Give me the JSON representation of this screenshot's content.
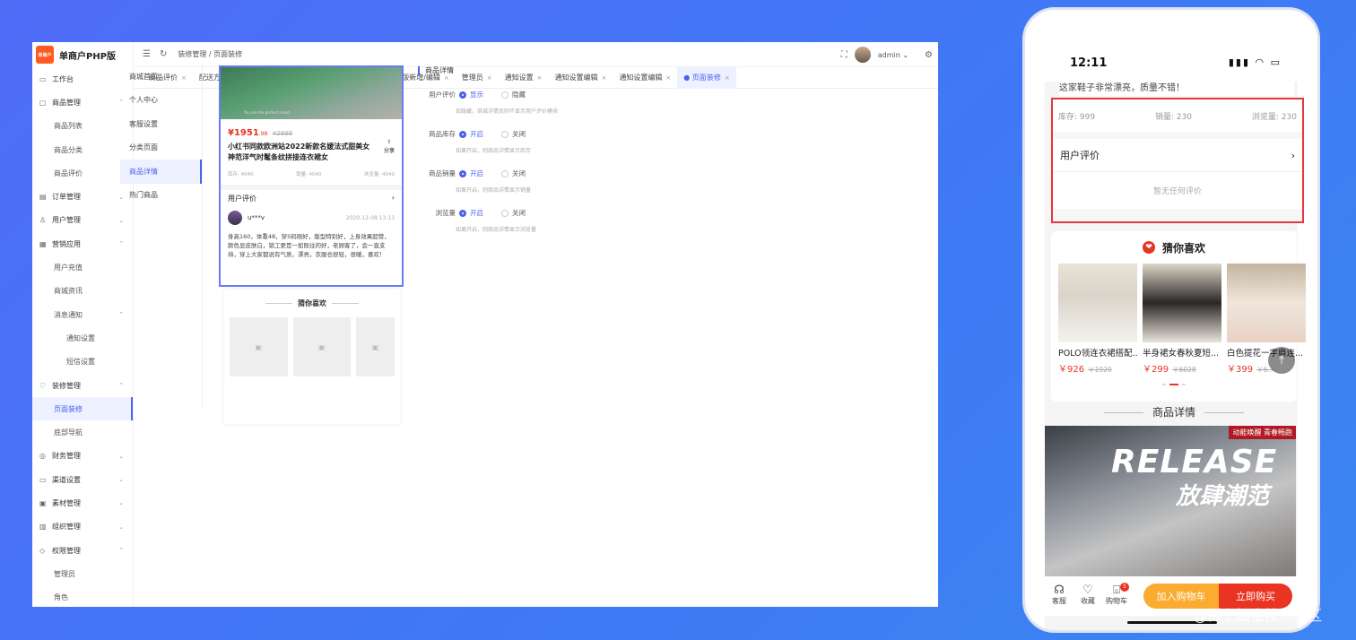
{
  "sidebar": {
    "brand_logo": "单商户",
    "brand_name": "单商户PHP版",
    "items": [
      {
        "label": "工作台",
        "level": "top",
        "icon": "▭",
        "chev": ""
      },
      {
        "label": "商品管理",
        "level": "top",
        "icon": "▢",
        "chev": "⌃"
      },
      {
        "label": "商品列表",
        "level": "sub"
      },
      {
        "label": "商品分类",
        "level": "sub"
      },
      {
        "label": "商品评价",
        "level": "sub"
      },
      {
        "label": "订单管理",
        "level": "top",
        "icon": "▤",
        "chev": "⌄"
      },
      {
        "label": "用户管理",
        "level": "top",
        "icon": "♙",
        "chev": "⌄"
      },
      {
        "label": "营销应用",
        "level": "top",
        "icon": "▦",
        "chev": "⌃"
      },
      {
        "label": "用户充值",
        "level": "sub"
      },
      {
        "label": "商城资讯",
        "level": "sub"
      },
      {
        "label": "消息通知",
        "level": "sub",
        "chev": "⌃"
      },
      {
        "label": "通知设置",
        "level": "sub2"
      },
      {
        "label": "短信设置",
        "level": "sub2"
      },
      {
        "label": "装修管理",
        "level": "top",
        "icon": "♡",
        "chev": "⌃"
      },
      {
        "label": "页面装修",
        "level": "sub",
        "active": true
      },
      {
        "label": "底部导航",
        "level": "sub"
      },
      {
        "label": "财务管理",
        "level": "top",
        "icon": "◎",
        "chev": "⌄"
      },
      {
        "label": "渠道设置",
        "level": "top",
        "icon": "▭",
        "chev": "⌄"
      },
      {
        "label": "素材管理",
        "level": "top",
        "icon": "▣",
        "chev": "⌄"
      },
      {
        "label": "组织管理",
        "level": "top",
        "icon": "▥",
        "chev": "⌄"
      },
      {
        "label": "权限管理",
        "level": "top",
        "icon": "◇",
        "chev": "⌃"
      },
      {
        "label": "管理员",
        "level": "sub"
      },
      {
        "label": "角色",
        "level": "sub"
      }
    ]
  },
  "topbar": {
    "collapse_icon": "☰",
    "refresh_icon": "↻",
    "breadcrumb": "装修管理  /  页面装修",
    "fullscreen_icon": "⛶",
    "user_name": "admin ⌄",
    "settings_icon": "⚙"
  },
  "tabs": [
    {
      "label": "商品评价"
    },
    {
      "label": "配送方式"
    },
    {
      "label": "运费模版"
    },
    {
      "label": "运费模版新增/编辑"
    },
    {
      "label": "运费模版新增/编辑"
    },
    {
      "label": "管理员"
    },
    {
      "label": "通知设置"
    },
    {
      "label": "通知设置编辑"
    },
    {
      "label": "通知设置编辑"
    },
    {
      "label": "● 页面装修",
      "active": true
    }
  ],
  "tab_close": "×",
  "subnav": [
    {
      "label": "商城首页"
    },
    {
      "label": "个人中心"
    },
    {
      "label": "客服设置"
    },
    {
      "label": "分类页面"
    },
    {
      "label": "商品详情",
      "active": true
    },
    {
      "label": "热门商品"
    }
  ],
  "preview": {
    "caption": "You are the perfect mood",
    "price": "¥1951",
    "price_decimal": ".98",
    "old_price": "¥2999",
    "title": "小红书同款欧洲站2022新款名媛法式甜美女神范洋气时髦条纹拼接连衣裙女",
    "share_icon": "⇪",
    "share_label": "分享",
    "stock": "库存: 4040",
    "sales": "销量: 4040",
    "views": "浏览量: 4040",
    "review_title": "用户评价",
    "review_arrow": "›",
    "user": "u***v",
    "time": "2020-12-08 13:13",
    "review_text": "身高160，体重48，穿S码刚好，版型特别好，上身效果超赞，颜色显皮肤白，锁工更是一如既往的好，老顾客了，会一直支持，穿上大家都说有气质，漂亮，衣服也很轻，很暖，喜欢！",
    "guess_title": "猜你喜欢",
    "img_icon": "▣"
  },
  "settings": {
    "header": "商品详情",
    "rows": [
      {
        "label": "用户评价",
        "opt_a": "显示",
        "opt_b": "隐藏",
        "hint": "如隐藏，商城详情页则不显示用户评价模块"
      },
      {
        "label": "商品库存",
        "opt_a": "开启",
        "opt_b": "关闭",
        "hint": "如果开启，则商品详情显示库存"
      },
      {
        "label": "商品销量",
        "opt_a": "开启",
        "opt_b": "关闭",
        "hint": "如果开启，则商品详情显示销量"
      },
      {
        "label": "浏览量",
        "opt_a": "开启",
        "opt_b": "关闭",
        "hint": "如果开启，则商品详情显示浏览量"
      }
    ]
  },
  "mobile": {
    "time": "12:11",
    "status_icons": "▮▮▮ ◠ ▭",
    "review_note": "这家鞋子非常漂亮，质量不错！",
    "stock": "库存: 999",
    "sales": "销量: 230",
    "views": "浏览量: 230",
    "review_title": "用户评价",
    "review_arrow": "›",
    "no_review": "暂无任何评价",
    "guess_title": "猜你喜欢",
    "heart_icon": "❤",
    "products": [
      {
        "name": "POLO领连衣裙搭配...",
        "price": "￥926",
        "old": "￥1920"
      },
      {
        "name": "半身裙女春秋夏短...",
        "price": "￥299",
        "old": "￥6028"
      },
      {
        "name": "白色提花一字肩连...",
        "price": "￥399",
        "old": "￥6..."
      }
    ],
    "back_top": "⤒",
    "detail_title": "商品详情",
    "banner_tag": "动能唤醒 青春畅跑",
    "banner_en": "RELEASE",
    "banner_cn": "放肆潮范",
    "service_icon": "☊",
    "service": "客服",
    "fav_icon": "♡",
    "fav": "收藏",
    "cart_icon": "⌺",
    "cart_badge": "5",
    "cart": "购物车",
    "add_cart": "加入购物车",
    "buy_now": "立即购买"
  },
  "watermark": "@稀土掘金技术社区"
}
